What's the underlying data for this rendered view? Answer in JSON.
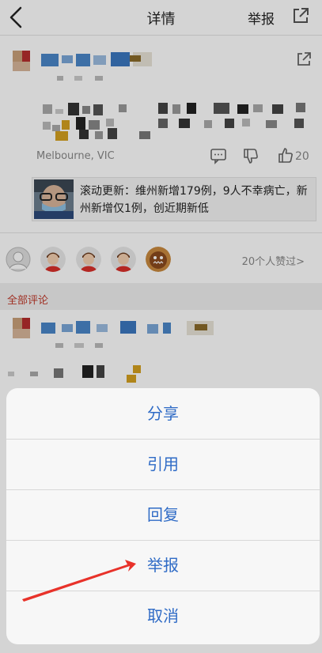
{
  "header": {
    "title": "详情",
    "report": "举报"
  },
  "post": {
    "location": "Melbourne, VIC",
    "like_count": "20"
  },
  "news_card": {
    "text": "滚动更新：维州新增179例，9人不幸病亡，新州新增仅1例，创近期新低"
  },
  "likers": {
    "text": "20个人赞过>"
  },
  "comments": {
    "section_label": "全部评论"
  },
  "action_sheet": {
    "items": [
      "分享",
      "引用",
      "回复",
      "举报",
      "取消"
    ]
  },
  "colors": {
    "accent_blue": "#2f6bc6",
    "section_red": "#c0392b",
    "arrow_red": "#e8322a"
  }
}
